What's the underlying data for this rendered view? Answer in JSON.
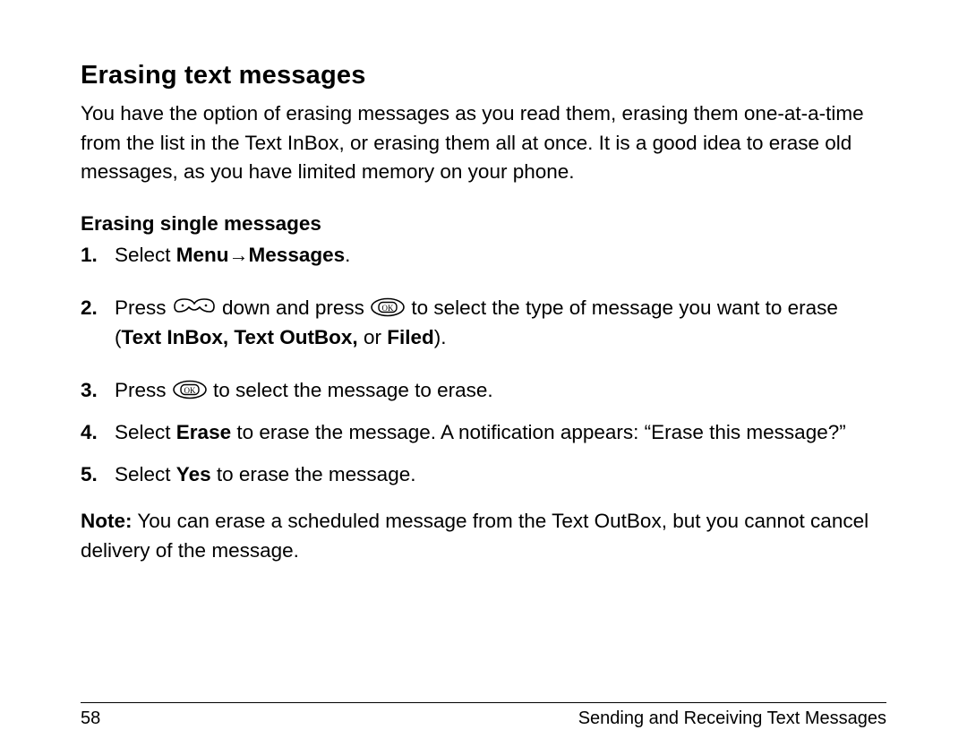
{
  "heading": "Erasing text messages",
  "intro": "You have the option of erasing messages as you read them, erasing them one-at-a-time from the list in the Text InBox, or erasing them all at once. It is a good idea to erase old messages, as you have limited memory on your phone.",
  "subheading": "Erasing single messages",
  "step1": {
    "num": "1.",
    "pre": "Select ",
    "menu": "Menu",
    "arrow": " → ",
    "messages": "Messages",
    "period": "."
  },
  "step2": {
    "num": "2.",
    "pre": "Press ",
    "mid1": " down and press ",
    "mid2": " to select the type of message you want to erase (",
    "bold": "Text InBox, Text OutBox,",
    "or": " or ",
    "filed": "Filed",
    "end": ")."
  },
  "step3": {
    "num": "3.",
    "pre": "Press ",
    "post": " to select the message to erase."
  },
  "step4": {
    "num": "4.",
    "pre": "Select ",
    "erase": "Erase",
    "post": " to erase the message. A notification appears: “Erase this message?”"
  },
  "step5": {
    "num": "5.",
    "pre": "Select ",
    "yes": "Yes",
    "post": " to erase the message."
  },
  "note": {
    "label": "Note:",
    "text": " You can erase a scheduled message from the Text OutBox, but you cannot cancel delivery of the message."
  },
  "footer": {
    "page": "58",
    "chapter": "Sending and Receiving Text Messages"
  }
}
